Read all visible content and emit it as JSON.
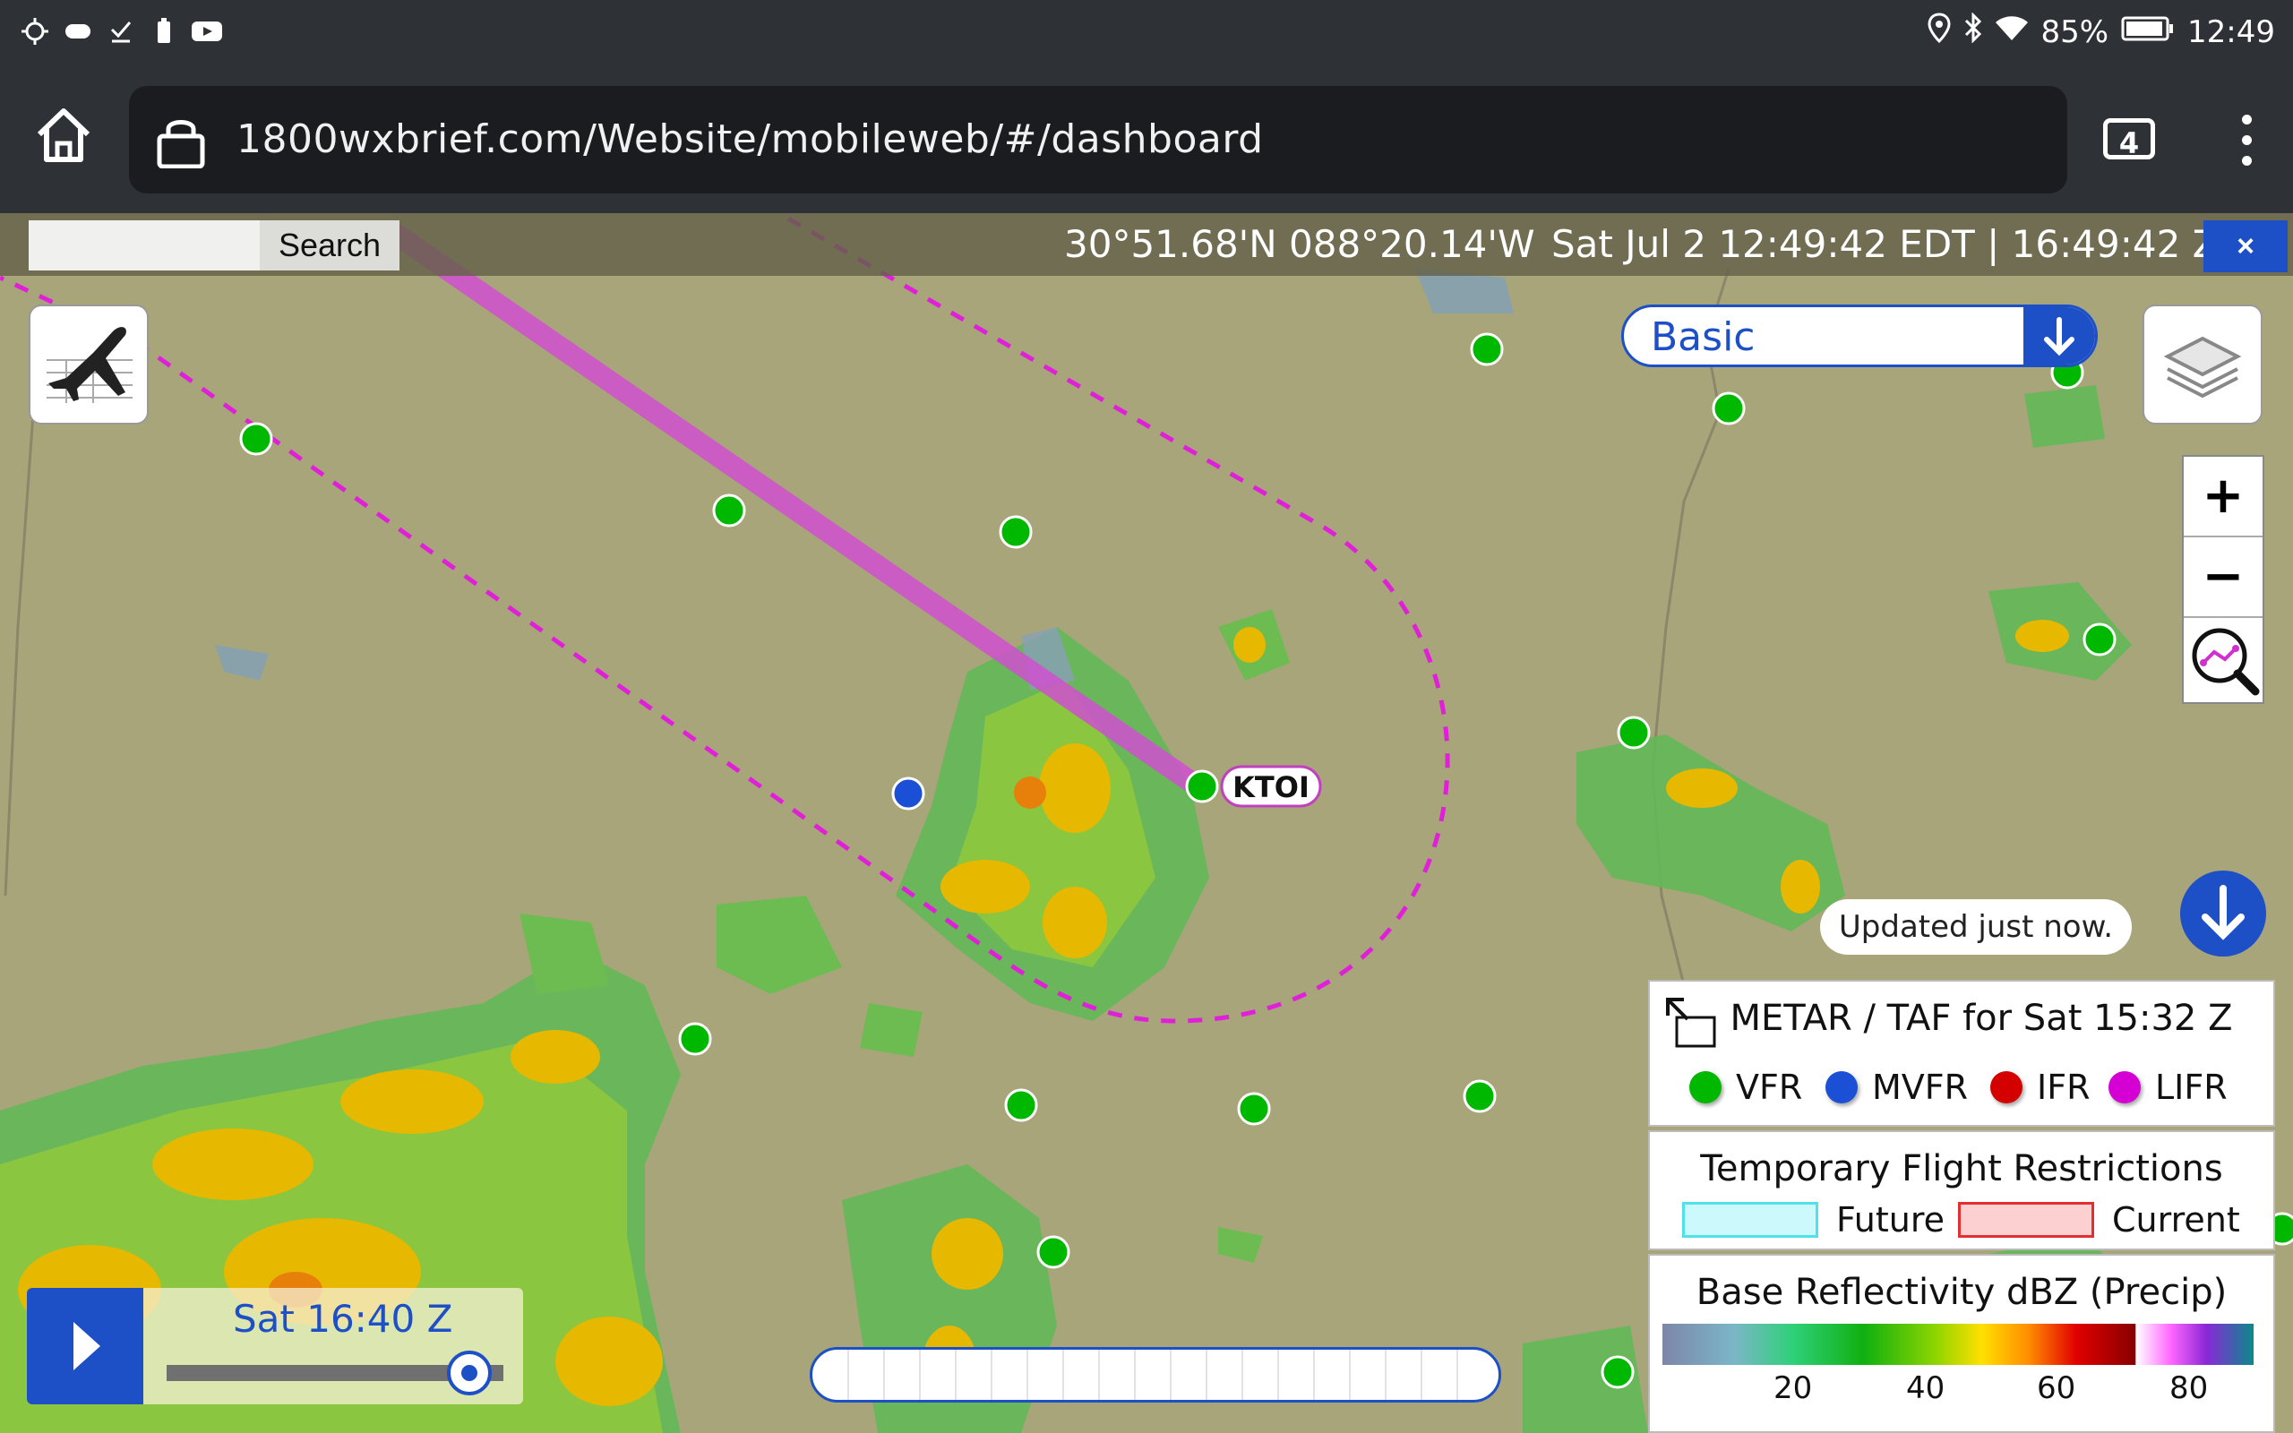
{
  "status_bar": {
    "battery": "85%",
    "time": "12:49",
    "icons": [
      "location-target-icon",
      "gamepad-icon",
      "download-done-icon",
      "battery-saver-icon",
      "youtube-icon",
      "location-icon",
      "bluetooth-icon",
      "wifi-icon",
      "battery-icon"
    ]
  },
  "browser": {
    "url": "1800wxbrief.com/Website/mobileweb/#/dashboard",
    "tab_count": "4"
  },
  "infobar": {
    "search_placeholder": "",
    "search_button": "Search",
    "coordinates": "30°51.68'N 088°20.14'W",
    "datetime": "Sat Jul 2 12:49:42 EDT | 16:49:42 Z",
    "close_label": "×"
  },
  "map": {
    "airport_label": "KTOI",
    "basemap_selected": "Basic",
    "zoom_in_label": "+",
    "zoom_out_label": "−",
    "updated_text": "Updated just now.",
    "route_color": "#d050d0",
    "background_color": "#a8a57a"
  },
  "legend": {
    "metar_title": "METAR / TAF for Sat 15:32 Z",
    "categories": [
      {
        "label": "VFR",
        "color": "#00b800"
      },
      {
        "label": "MVFR",
        "color": "#1a4fd6"
      },
      {
        "label": "IFR",
        "color": "#d40000"
      },
      {
        "label": "LIFR",
        "color": "#d400d4"
      }
    ],
    "tfr_title": "Temporary Flight Restrictions",
    "tfr_future": "Future",
    "tfr_current": "Current",
    "radar_title": "Base Reflectivity dBZ (Precip)",
    "radar_ticks": [
      "20",
      "40",
      "60",
      "80"
    ]
  },
  "playback": {
    "time_label": "Sat 16:40 Z",
    "progress": 0.9
  },
  "accent_color": "#1d4fc7"
}
